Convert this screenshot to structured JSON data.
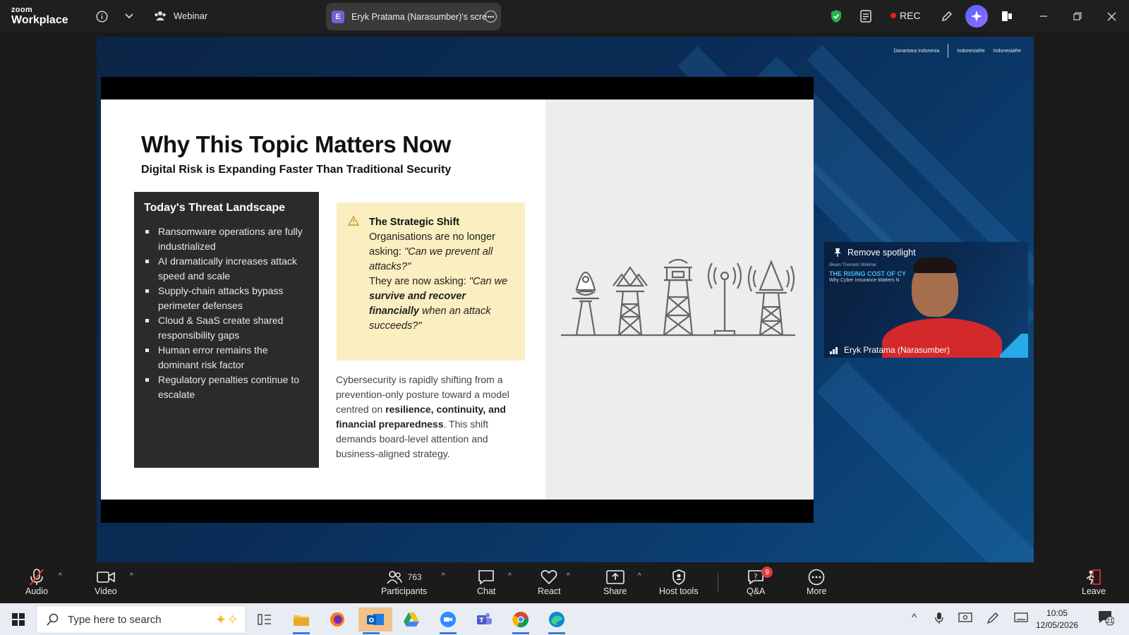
{
  "titlebar": {
    "logo_line1": "zoom",
    "logo_line2": "Workplace",
    "webinar_label": "Webinar",
    "share_tab_initial": "E",
    "share_tab_label": "Eryk Pratama (Narasumber)'s scre",
    "rec_label": "REC"
  },
  "stage": {
    "partners": [
      "Danantara Indonesia",
      "IndonesiaRe",
      "IndonesiaRe"
    ],
    "slide": {
      "title": "Why This Topic Matters Now",
      "subtitle": "Digital Risk is Expanding Faster Than Traditional Security",
      "threat_heading": "Today's Threat Landscape",
      "threats": [
        "Ransomware operations are fully industrialized",
        "AI dramatically increases attack speed and scale",
        "Supply-chain attacks bypass perimeter defenses",
        "Cloud & SaaS create shared responsibility gaps",
        "Human error remains the dominant risk factor",
        "Regulatory penalties continue to escalate"
      ],
      "shift_heading": "The Strategic Shift",
      "shift_line1": "Organisations are no longer asking: ",
      "shift_q1": "\"Can we prevent all attacks?\"",
      "shift_line2": "They are now asking: ",
      "shift_q2a": "\"Can we ",
      "shift_q2b": "survive and recover financially",
      "shift_q2c": " when an attack succeeds?\"",
      "body_a": "Cybersecurity is rapidly shifting from a prevention-only posture toward a model centred on ",
      "body_b": "resilience, continuity, and financial preparedness",
      "body_c": ". This shift demands board-level attention and business-aligned strategy."
    },
    "video": {
      "spotlight_label": "Remove spotlight",
      "small_text": "iBeam Thematic Webinar",
      "title_text": "THE RISING COST OF CY",
      "sub_text": "Why Cyber Insurance Matters N",
      "participant_name": "Eryk Pratama (Narasumber)"
    }
  },
  "toolbar": {
    "audio": "Audio",
    "video": "Video",
    "participants": "Participants",
    "participants_count": "763",
    "chat": "Chat",
    "react": "React",
    "share": "Share",
    "host_tools": "Host tools",
    "qa": "Q&A",
    "qa_badge": "9",
    "more": "More",
    "leave": "Leave"
  },
  "taskbar": {
    "search_placeholder": "Type here to search",
    "time": "10:05",
    "date": "12/05/2026",
    "notif_count": "21"
  },
  "colors": {
    "accent_blue": "#48b6f0",
    "rec_red": "#e02020",
    "shift_bg": "#fbeec0"
  }
}
